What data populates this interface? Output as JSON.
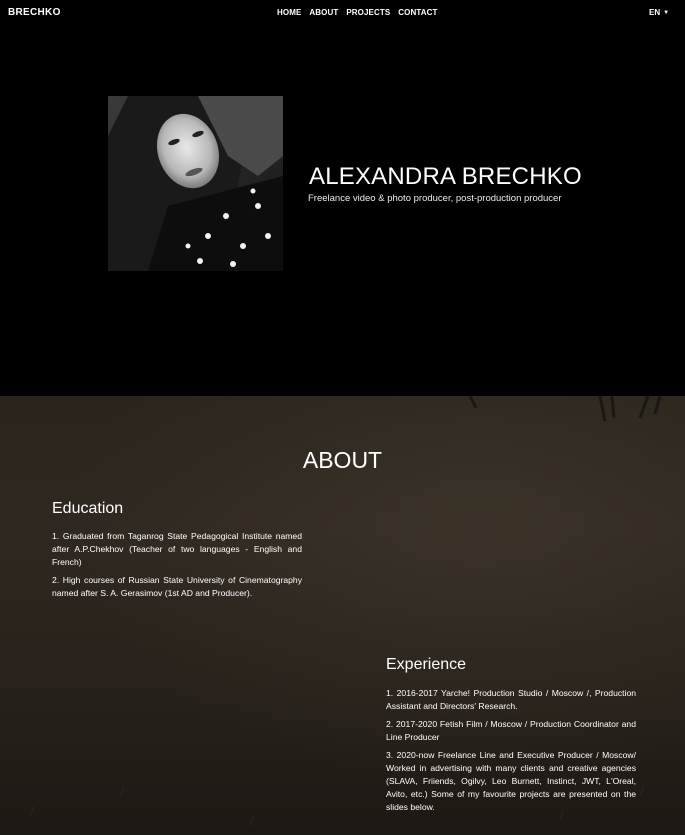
{
  "navbar": {
    "brand": "BRECHKO",
    "links": [
      "HOME",
      "ABOUT",
      "PROJECTS",
      "CONTACT"
    ],
    "language": "EN"
  },
  "hero": {
    "name": "ALEXANDRA BRECHKO",
    "subtitle": "Freelance video & photo producer, post-production producer"
  },
  "about": {
    "title": "ABOUT",
    "education": {
      "title": "Education",
      "items": [
        "1. Graduated from Taganrog State Pedagogical Institute named after A.P.Chekhov (Teacher of two languages - English and French)",
        "2. High courses of Russian State University of Cinematography named after S. A. Gerasimov (1st AD and Producer)."
      ]
    },
    "experience": {
      "title": "Experience",
      "items": [
        "1. 2016-2017 Yarche! Production Studio / Moscow /, Production Assistant and Directors' Research.",
        "2. 2017-2020 Fetish Film / Moscow / Production Coordinator and Line Producer",
        "3. 2020-now Freelance Line and Executive Producer / Moscow/ Worked in advertising with many clients and creative agencies (SLAVA, Friiends, Ogilvy, Leo Burnett, Instinct, JWT, L'Oreal, Avito, etc.) Some of my favourite projects are presented on the slides below."
      ]
    }
  },
  "icons": {
    "language_caret": "caret-down-icon"
  }
}
